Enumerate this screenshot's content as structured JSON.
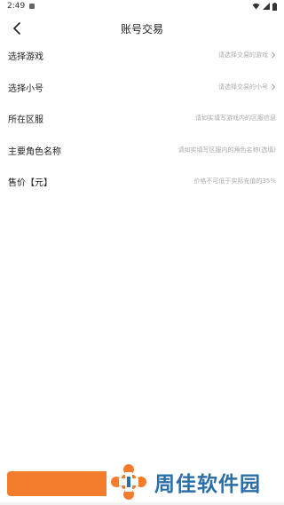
{
  "status_bar": {
    "time": "2:49"
  },
  "header": {
    "title": "账号交易"
  },
  "form": {
    "rows": [
      {
        "label": "选择游戏",
        "placeholder": "请选择交易的游戏",
        "has_chevron": true
      },
      {
        "label": "选择小号",
        "placeholder": "请选择交易的小号",
        "has_chevron": true
      },
      {
        "label": "所在区服",
        "placeholder": "请如实填写游戏内的区服信息",
        "has_chevron": false
      },
      {
        "label": "主要角色名称",
        "placeholder": "请如实填写区服内的角色名称(选填)",
        "has_chevron": false
      },
      {
        "label": "售价【元】",
        "placeholder": "价格不可低于实际充值的35%",
        "has_chevron": false
      }
    ]
  },
  "watermark": {
    "text": "周佳软件园"
  },
  "colors": {
    "accent": "#f37d2d",
    "watermark_blue": "#2b6ea8",
    "placeholder": "#aaaaaa"
  }
}
